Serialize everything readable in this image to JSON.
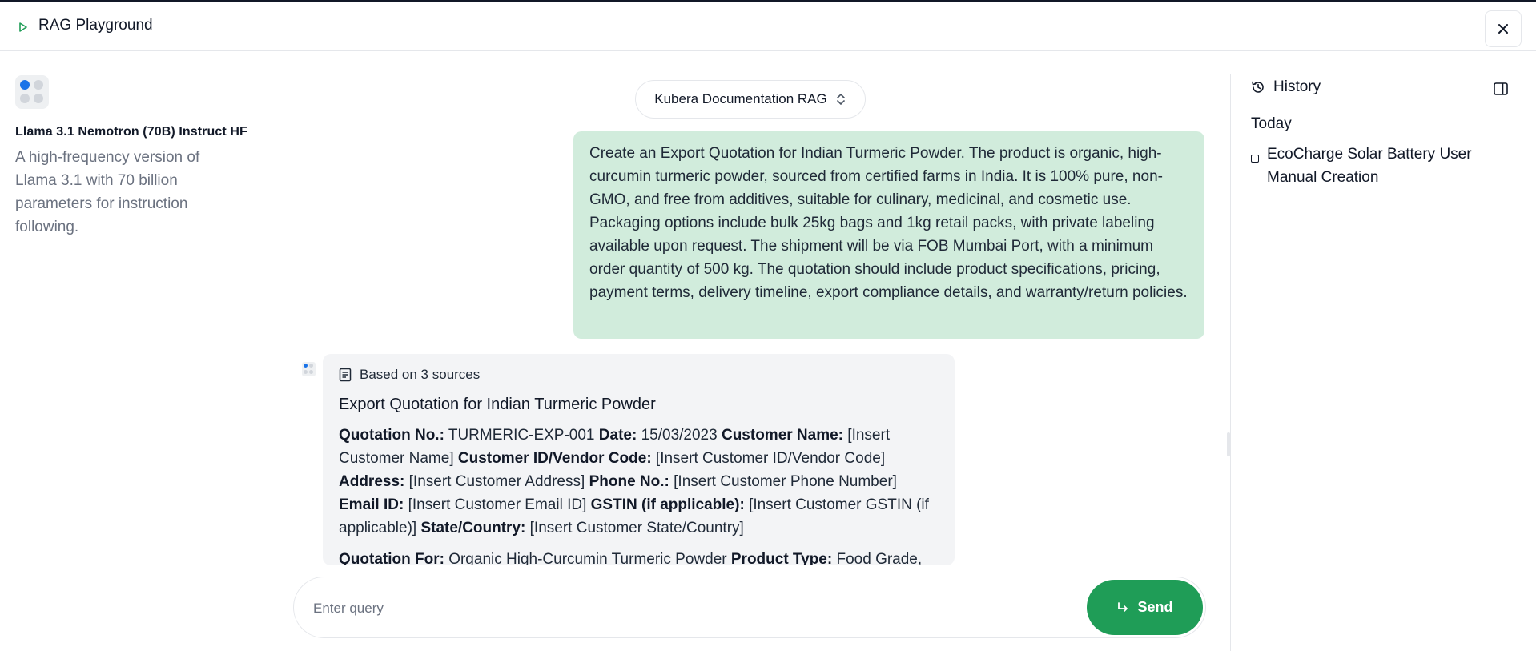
{
  "app": {
    "title": "RAG Playground"
  },
  "model": {
    "name": "Llama 3.1 Nemotron (70B) Instruct HF",
    "description": "A high-frequency version of Llama 3.1 with 70 billion parameters for instruction following."
  },
  "rag_selector": {
    "selected": "Kubera Documentation RAG"
  },
  "conversation": {
    "user_message": "Create an Export Quotation for Indian Turmeric Powder. The product is organic, high-curcumin turmeric powder, sourced from certified farms in India. It is 100% pure, non-GMO, and free from additives, suitable for culinary, medicinal, and cosmetic use. Packaging options include bulk 25kg bags and 1kg retail packs, with private labeling available upon request. The shipment will be via FOB Mumbai Port, with a minimum order quantity of 500 kg. The quotation should include product specifications, pricing, payment terms, delivery timeline, export compliance details, and warranty/return policies.",
    "bot": {
      "sources_label": "Based on 3 sources",
      "heading": "Export Quotation for Indian Turmeric Powder",
      "fields": [
        {
          "label": "Quotation No.:",
          "value": "TURMERIC-EXP-001"
        },
        {
          "label": "Date:",
          "value": "15/03/2023"
        },
        {
          "label": "Customer Name:",
          "value": "[Insert Customer Name]"
        },
        {
          "label": "Customer ID/Vendor Code:",
          "value": "[Insert Customer ID/Vendor Code]"
        },
        {
          "label": "Address:",
          "value": "[Insert Customer Address]"
        },
        {
          "label": "Phone No.:",
          "value": "[Insert Customer Phone Number]"
        },
        {
          "label": "Email ID:",
          "value": "[Insert Customer Email ID]"
        },
        {
          "label": "GSTIN (if applicable):",
          "value": "[Insert Customer GSTIN (if applicable)]"
        },
        {
          "label": "State/Country:",
          "value": "[Insert Customer State/Country]"
        }
      ],
      "fields2": [
        {
          "label": "Quotation For:",
          "value": "Organic High-Curcumin Turmeric Powder"
        },
        {
          "label": "Product Type:",
          "value": "Food Grade,"
        }
      ]
    }
  },
  "history": {
    "title": "History",
    "groups": [
      {
        "label": "Today",
        "items": [
          "EcoCharge Solar Battery User Manual Creation"
        ]
      }
    ]
  },
  "composer": {
    "placeholder": "Enter query",
    "send_label": "Send"
  },
  "colors": {
    "accent": "#1f9d57",
    "user_bubble": "#d1ecdc",
    "bot_bubble": "#f3f4f6"
  }
}
